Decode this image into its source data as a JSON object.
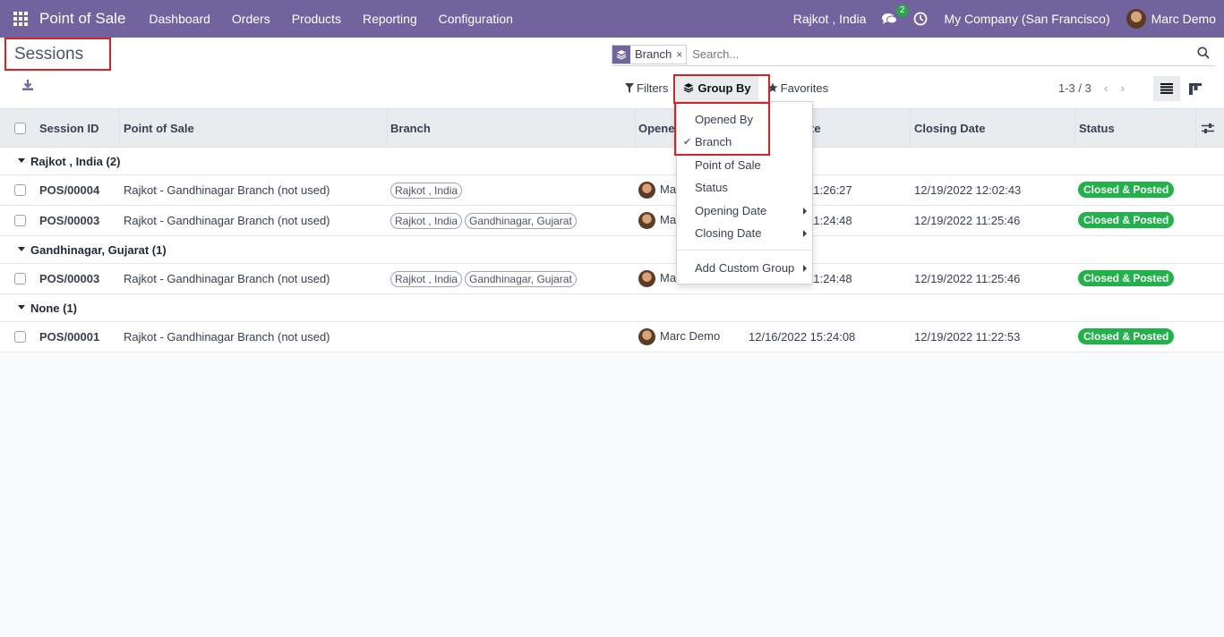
{
  "navbar": {
    "app_name": "Point of Sale",
    "menu": [
      "Dashboard",
      "Orders",
      "Products",
      "Reporting",
      "Configuration"
    ],
    "branch": "Rajkot , India",
    "chat_count": "2",
    "company": "My Company (San Francisco)",
    "user": "Marc Demo"
  },
  "page": {
    "title": "Sessions"
  },
  "search": {
    "facet_label": "Branch",
    "facet_close": "×",
    "placeholder": "Search..."
  },
  "controls": {
    "filters": "Filters",
    "group_by": "Group By",
    "favorites": "Favorites",
    "pager": "1-3 / 3",
    "pager_prev": "‹",
    "pager_next": "›"
  },
  "groupby_menu": {
    "items": [
      {
        "label": "Opened By",
        "checked": false,
        "submenu": false
      },
      {
        "label": "Branch",
        "checked": true,
        "submenu": false
      },
      {
        "label": "Point of Sale",
        "checked": false,
        "submenu": false
      },
      {
        "label": "Status",
        "checked": false,
        "submenu": false
      },
      {
        "label": "Opening Date",
        "checked": false,
        "submenu": true
      },
      {
        "label": "Closing Date",
        "checked": false,
        "submenu": true
      }
    ],
    "custom": "Add Custom Group"
  },
  "table": {
    "columns": [
      "Session ID",
      "Point of Sale",
      "Branch",
      "Opened By",
      "Opening Date",
      "Closing Date",
      "Status"
    ],
    "header_visible": {
      "opened_by": "Opene",
      "opening_date": "te"
    },
    "groups": [
      {
        "label": "Rajkot , India (2)",
        "rows": [
          {
            "id": "POS/00004",
            "pos": "Rajkot - Gandhinagar Branch (not used)",
            "branches": [
              "Rajkot , India"
            ],
            "opened_by": "Mar",
            "opening": "11:26:27",
            "closing": "12/19/2022 12:02:43",
            "status": "Closed & Posted"
          },
          {
            "id": "POS/00003",
            "pos": "Rajkot - Gandhinagar Branch (not used)",
            "branches": [
              "Rajkot , India",
              "Gandhinagar, Gujarat"
            ],
            "opened_by": "Mar",
            "opening": "11:24:48",
            "closing": "12/19/2022 11:25:46",
            "status": "Closed & Posted"
          }
        ]
      },
      {
        "label": "Gandhinagar, Gujarat (1)",
        "rows": [
          {
            "id": "POS/00003",
            "pos": "Rajkot - Gandhinagar Branch (not used)",
            "branches": [
              "Rajkot , India",
              "Gandhinagar, Gujarat"
            ],
            "opened_by": "Ma",
            "opening": "11:24:48",
            "closing": "12/19/2022 11:25:46",
            "status": "Closed & Posted"
          }
        ]
      },
      {
        "label": "None (1)",
        "rows": [
          {
            "id": "POS/00001",
            "pos": "Rajkot - Gandhinagar Branch (not used)",
            "branches": [],
            "opened_by": "Marc Demo",
            "opening": "12/16/2022 15:24:08",
            "closing": "12/19/2022 11:22:53",
            "status": "Closed & Posted"
          }
        ]
      }
    ]
  },
  "colors": {
    "navbar": "#71639e",
    "status_green": "#21b24a",
    "highlight_red": "#e02020"
  },
  "icons": [
    "apps-grid-icon",
    "chat-icon",
    "clock-icon",
    "download-icon",
    "layers-icon",
    "search-icon",
    "filter-icon",
    "star-icon",
    "list-view-icon",
    "kanban-view-icon",
    "optional-columns-icon"
  ]
}
